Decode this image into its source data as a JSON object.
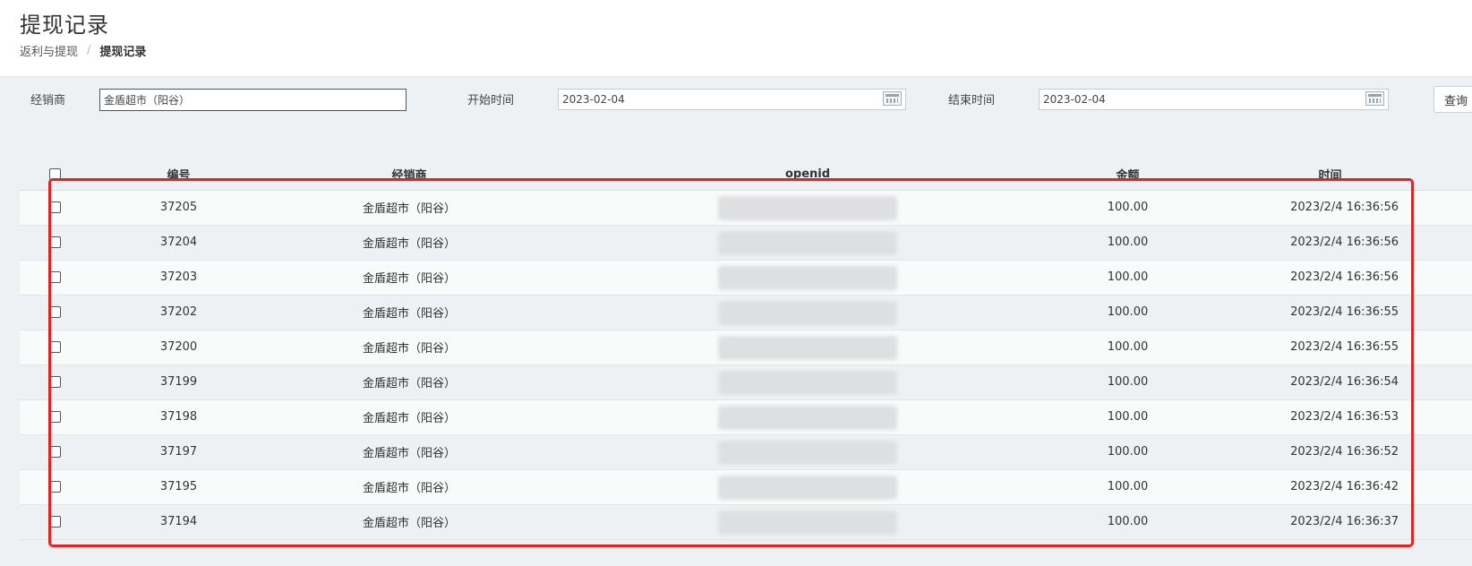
{
  "header": {
    "title": "提现记录",
    "breadcrumb": {
      "parent": "返利与提现",
      "separator": "/",
      "current": "提现记录"
    }
  },
  "filter": {
    "dealer_label": "经销商",
    "dealer_value": "金盾超市（阳谷）",
    "start_label": "开始时间",
    "start_value": "2023-02-04",
    "end_label": "结束时间",
    "end_value": "2023-02-04",
    "query_label": "查询"
  },
  "table": {
    "columns": [
      "编号",
      "经销商",
      "openid",
      "金额",
      "时间"
    ],
    "rows": [
      {
        "id": "37205",
        "dealer": "金盾超市（阳谷）",
        "amount": "100.00",
        "time": "2023/2/4 16:36:56"
      },
      {
        "id": "37204",
        "dealer": "金盾超市（阳谷）",
        "amount": "100.00",
        "time": "2023/2/4 16:36:56"
      },
      {
        "id": "37203",
        "dealer": "金盾超市（阳谷）",
        "amount": "100.00",
        "time": "2023/2/4 16:36:56"
      },
      {
        "id": "37202",
        "dealer": "金盾超市（阳谷）",
        "amount": "100.00",
        "time": "2023/2/4 16:36:55"
      },
      {
        "id": "37200",
        "dealer": "金盾超市（阳谷）",
        "amount": "100.00",
        "time": "2023/2/4 16:36:55"
      },
      {
        "id": "37199",
        "dealer": "金盾超市（阳谷）",
        "amount": "100.00",
        "time": "2023/2/4 16:36:54"
      },
      {
        "id": "37198",
        "dealer": "金盾超市（阳谷）",
        "amount": "100.00",
        "time": "2023/2/4 16:36:53"
      },
      {
        "id": "37197",
        "dealer": "金盾超市（阳谷）",
        "amount": "100.00",
        "time": "2023/2/4 16:36:52"
      },
      {
        "id": "37195",
        "dealer": "金盾超市（阳谷）",
        "amount": "100.00",
        "time": "2023/2/4 16:36:42"
      },
      {
        "id": "37194",
        "dealer": "金盾超市（阳谷）",
        "amount": "100.00",
        "time": "2023/2/4 16:36:37"
      }
    ]
  },
  "colors": {
    "highlight": "#e32222",
    "header_bg": "#ffffff",
    "page_bg": "#eef1f3"
  },
  "icons": {
    "date_picker": "calendar-icon"
  }
}
